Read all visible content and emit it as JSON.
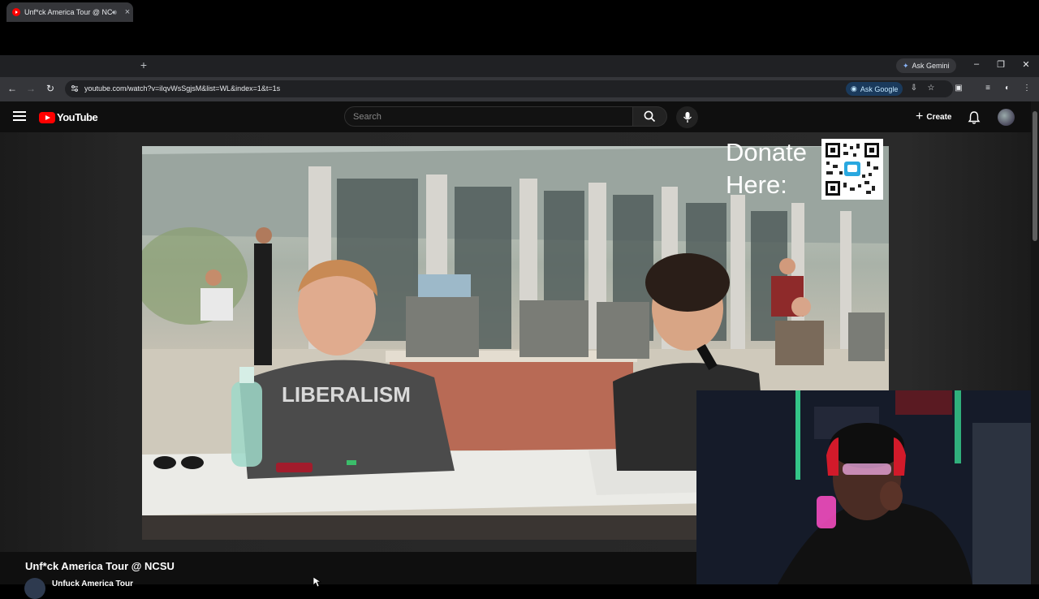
{
  "browser": {
    "tab": {
      "title": "Unf*ck America Tour @ NC",
      "favicon": "youtube-favicon-icon",
      "audio_icon": "speaker-icon",
      "close": "×"
    },
    "new_tab": "+",
    "ask_gemini": "Ask Gemini",
    "window_controls": [
      "–",
      "❐",
      "✕"
    ],
    "url": "youtube.com/watch?v=iIqvWsSgjsM&list=WL&index=1&t=1s",
    "ask_google": "Ask Google"
  },
  "youtube": {
    "logo_text": "YouTube",
    "search_placeholder": "Search",
    "create_label": "Create",
    "video": {
      "donate_text": "Donate Here:",
      "title": "Unf*ck America Tour @ NCSU",
      "channel": "Unfuck America Tour"
    }
  },
  "colors": {
    "brand_red": "#ff0000",
    "page_bg": "#0f0f0f",
    "chrome_bg": "#35363a"
  }
}
